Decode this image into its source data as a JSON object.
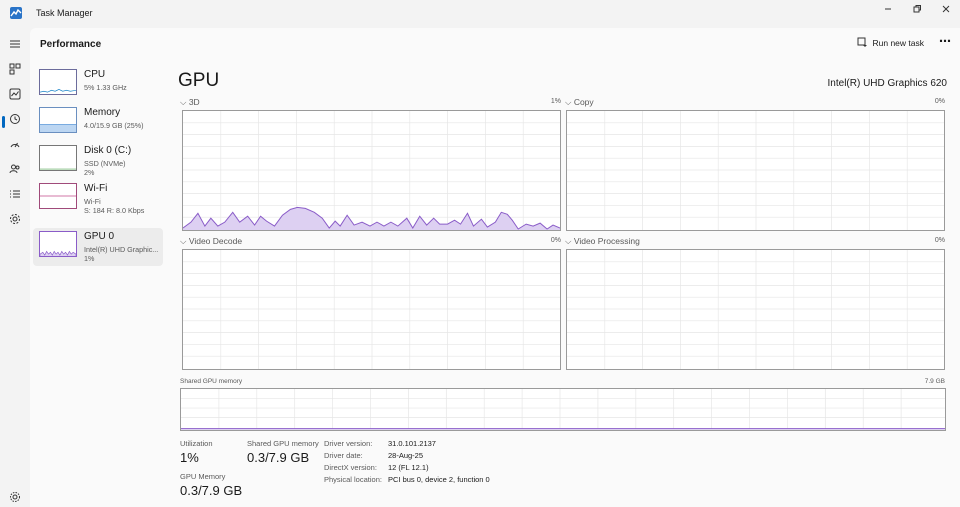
{
  "window": {
    "title": "Task Manager"
  },
  "header": {
    "title": "Performance",
    "run_new_task": "Run new task",
    "more": "⋯"
  },
  "nav_items": [
    "menu-icon",
    "processes-icon",
    "performance-icon",
    "app-history-icon",
    "startup-apps-icon",
    "users-icon",
    "details-icon",
    "services-icon",
    "settings-icon"
  ],
  "devices": [
    {
      "name": "CPU",
      "sub1": "5%  1.33 GHz",
      "sub2": ""
    },
    {
      "name": "Memory",
      "sub1": "4.0/15.9 GB (25%)",
      "sub2": ""
    },
    {
      "name": "Disk 0 (C:)",
      "sub1": "SSD (NVMe)",
      "sub2": "2%"
    },
    {
      "name": "Wi-Fi",
      "sub1": "Wi-Fi",
      "sub2": "S: 184  R: 8.0 Kbps"
    },
    {
      "name": "GPU 0",
      "sub1": "Intel(R) UHD Graphic...",
      "sub2": "1%"
    }
  ],
  "main": {
    "title": "GPU",
    "model": "Intel(R) UHD Graphics 620"
  },
  "graphs": {
    "g3d": {
      "label": "3D",
      "pct": "1%"
    },
    "copy": {
      "label": "Copy",
      "pct": "0%"
    },
    "decode": {
      "label": "Video Decode",
      "pct": "0%"
    },
    "processing": {
      "label": "Video Processing",
      "pct": "0%"
    },
    "shared": {
      "label": "Shared GPU memory",
      "max": "7.9 GB"
    }
  },
  "stats": {
    "utilization_label": "Utilization",
    "utilization": "1%",
    "shared_label": "Shared GPU memory",
    "shared": "0.3/7.9 GB",
    "gpu_mem_label": "GPU Memory",
    "gpu_mem": "0.3/7.9 GB"
  },
  "info": [
    {
      "label": "Driver version:",
      "value": "31.0.101.2137"
    },
    {
      "label": "Driver date:",
      "value": "28-Aug-25"
    },
    {
      "label": "DirectX version:",
      "value": "12 (FL 12.1)"
    },
    {
      "label": "Physical location:",
      "value": "PCI bus 0, device 2, function 0"
    }
  ],
  "colors": {
    "accent": "#0067c0",
    "gpu_line": "#8a5cc8",
    "gpu_fill": "#ddd0f2",
    "grid": "#e6e6e6",
    "border": "#9a9a9a"
  }
}
